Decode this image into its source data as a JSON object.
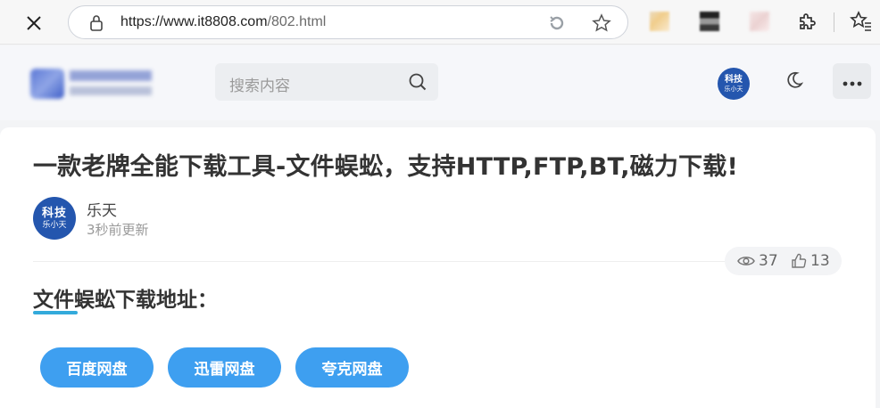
{
  "browser": {
    "url_host": "https://www.it8808.com",
    "url_path": "/802.html",
    "icons": [
      "close-icon",
      "lock-icon",
      "reload-tracking-icon",
      "favorite-star-icon",
      "extension-icon",
      "puzzle-icon",
      "favorites-icon"
    ]
  },
  "header": {
    "search_placeholder": "搜索内容",
    "avatar_line1": "科技",
    "avatar_line2": "乐小天",
    "icons": [
      "search-icon",
      "moon-icon",
      "more-icon"
    ]
  },
  "article": {
    "title": "一款老牌全能下载工具-文件蜈蚣，支持HTTP,FTP,BT,磁力下载!",
    "author_avatar_line1": "科技",
    "author_avatar_line2": "乐小天",
    "author_name": "乐天",
    "updated": "3秒前更新",
    "views": "37",
    "likes": "13",
    "section_title": "文件蜈蚣下载地址：",
    "buttons": [
      {
        "label": "百度网盘"
      },
      {
        "label": "迅雷网盘"
      },
      {
        "label": "夸克网盘"
      }
    ]
  },
  "colors": {
    "accent": "#3e9ff0",
    "underline": "#33aadb",
    "avatar": "#2456ae"
  }
}
